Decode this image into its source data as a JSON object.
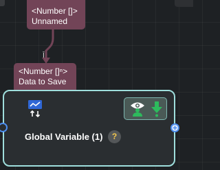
{
  "output_tag": {
    "type": "<Number []>",
    "name": "Unnamed"
  },
  "port_marker": "Ī",
  "input_tag": {
    "type": "<Number []ⁿ>",
    "name": "Data to Save"
  },
  "node": {
    "title": "Global Variable (1)",
    "help_symbol": "?",
    "icons": {
      "node_icon": "chart-transfer-icon",
      "visibility": "user-eye-icon",
      "download": "download-arrow-icon",
      "add_port": "plus-circle-icon"
    }
  },
  "colors": {
    "tag_background": "#724457",
    "node_border": "#9fdfdd",
    "port_blue": "#4d8ff0",
    "action_green": "#2dbb5d",
    "help_yellow": "#f4c84e"
  }
}
